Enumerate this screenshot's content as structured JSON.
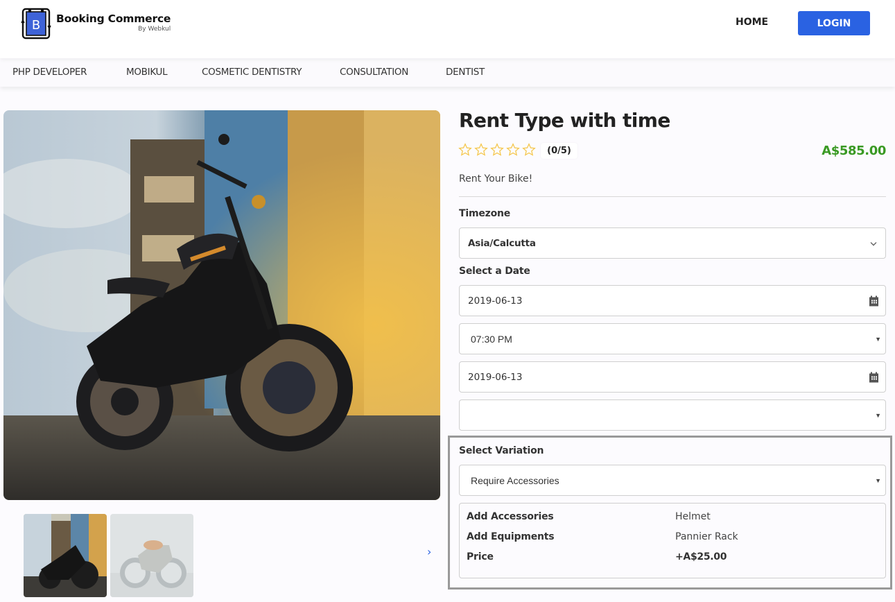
{
  "header": {
    "logo_title": "Booking Commerce",
    "logo_subtitle": "By Webkul",
    "logo_letter": "B",
    "nav_home": "HOME",
    "login_label": "LOGIN",
    "brand_color": "#2a62e2"
  },
  "categories": [
    {
      "label": "PHP DEVELOPER"
    },
    {
      "label": "MOBIKUL"
    },
    {
      "label": "COSMETIC DENTISTRY"
    },
    {
      "label": "CONSULTATION"
    },
    {
      "label": "DENTIST"
    }
  ],
  "gallery": {
    "main_image": "motorcycle-photo",
    "thumbnails": [
      {
        "name": "black-motorcycle-thumbnail",
        "selected": true
      },
      {
        "name": "vintage-motorcycle-thumbnail",
        "selected": false
      }
    ],
    "next_icon": "chevron-right-icon"
  },
  "product": {
    "title": "Rent Type with time",
    "rating": 0,
    "rating_max": 5,
    "rating_text": "(0/5)",
    "price": "A$585.00",
    "price_color": "#3a9a24",
    "description": "Rent Your Bike!"
  },
  "form": {
    "timezone_label": "Timezone",
    "timezone_value": "Asia/Calcutta",
    "date_label": "Select a Date",
    "start_date": "2019-06-13",
    "start_time": "07:30 PM",
    "end_date": "2019-06-13",
    "end_time": ""
  },
  "variation": {
    "label": "Select Variation",
    "selected": "Require Accessories",
    "details": [
      {
        "key": "Add Accessories",
        "value": "Helmet"
      },
      {
        "key": "Add Equipments",
        "value": "Pannier Rack"
      },
      {
        "key": "Price",
        "value": "+A$25.00"
      }
    ]
  }
}
